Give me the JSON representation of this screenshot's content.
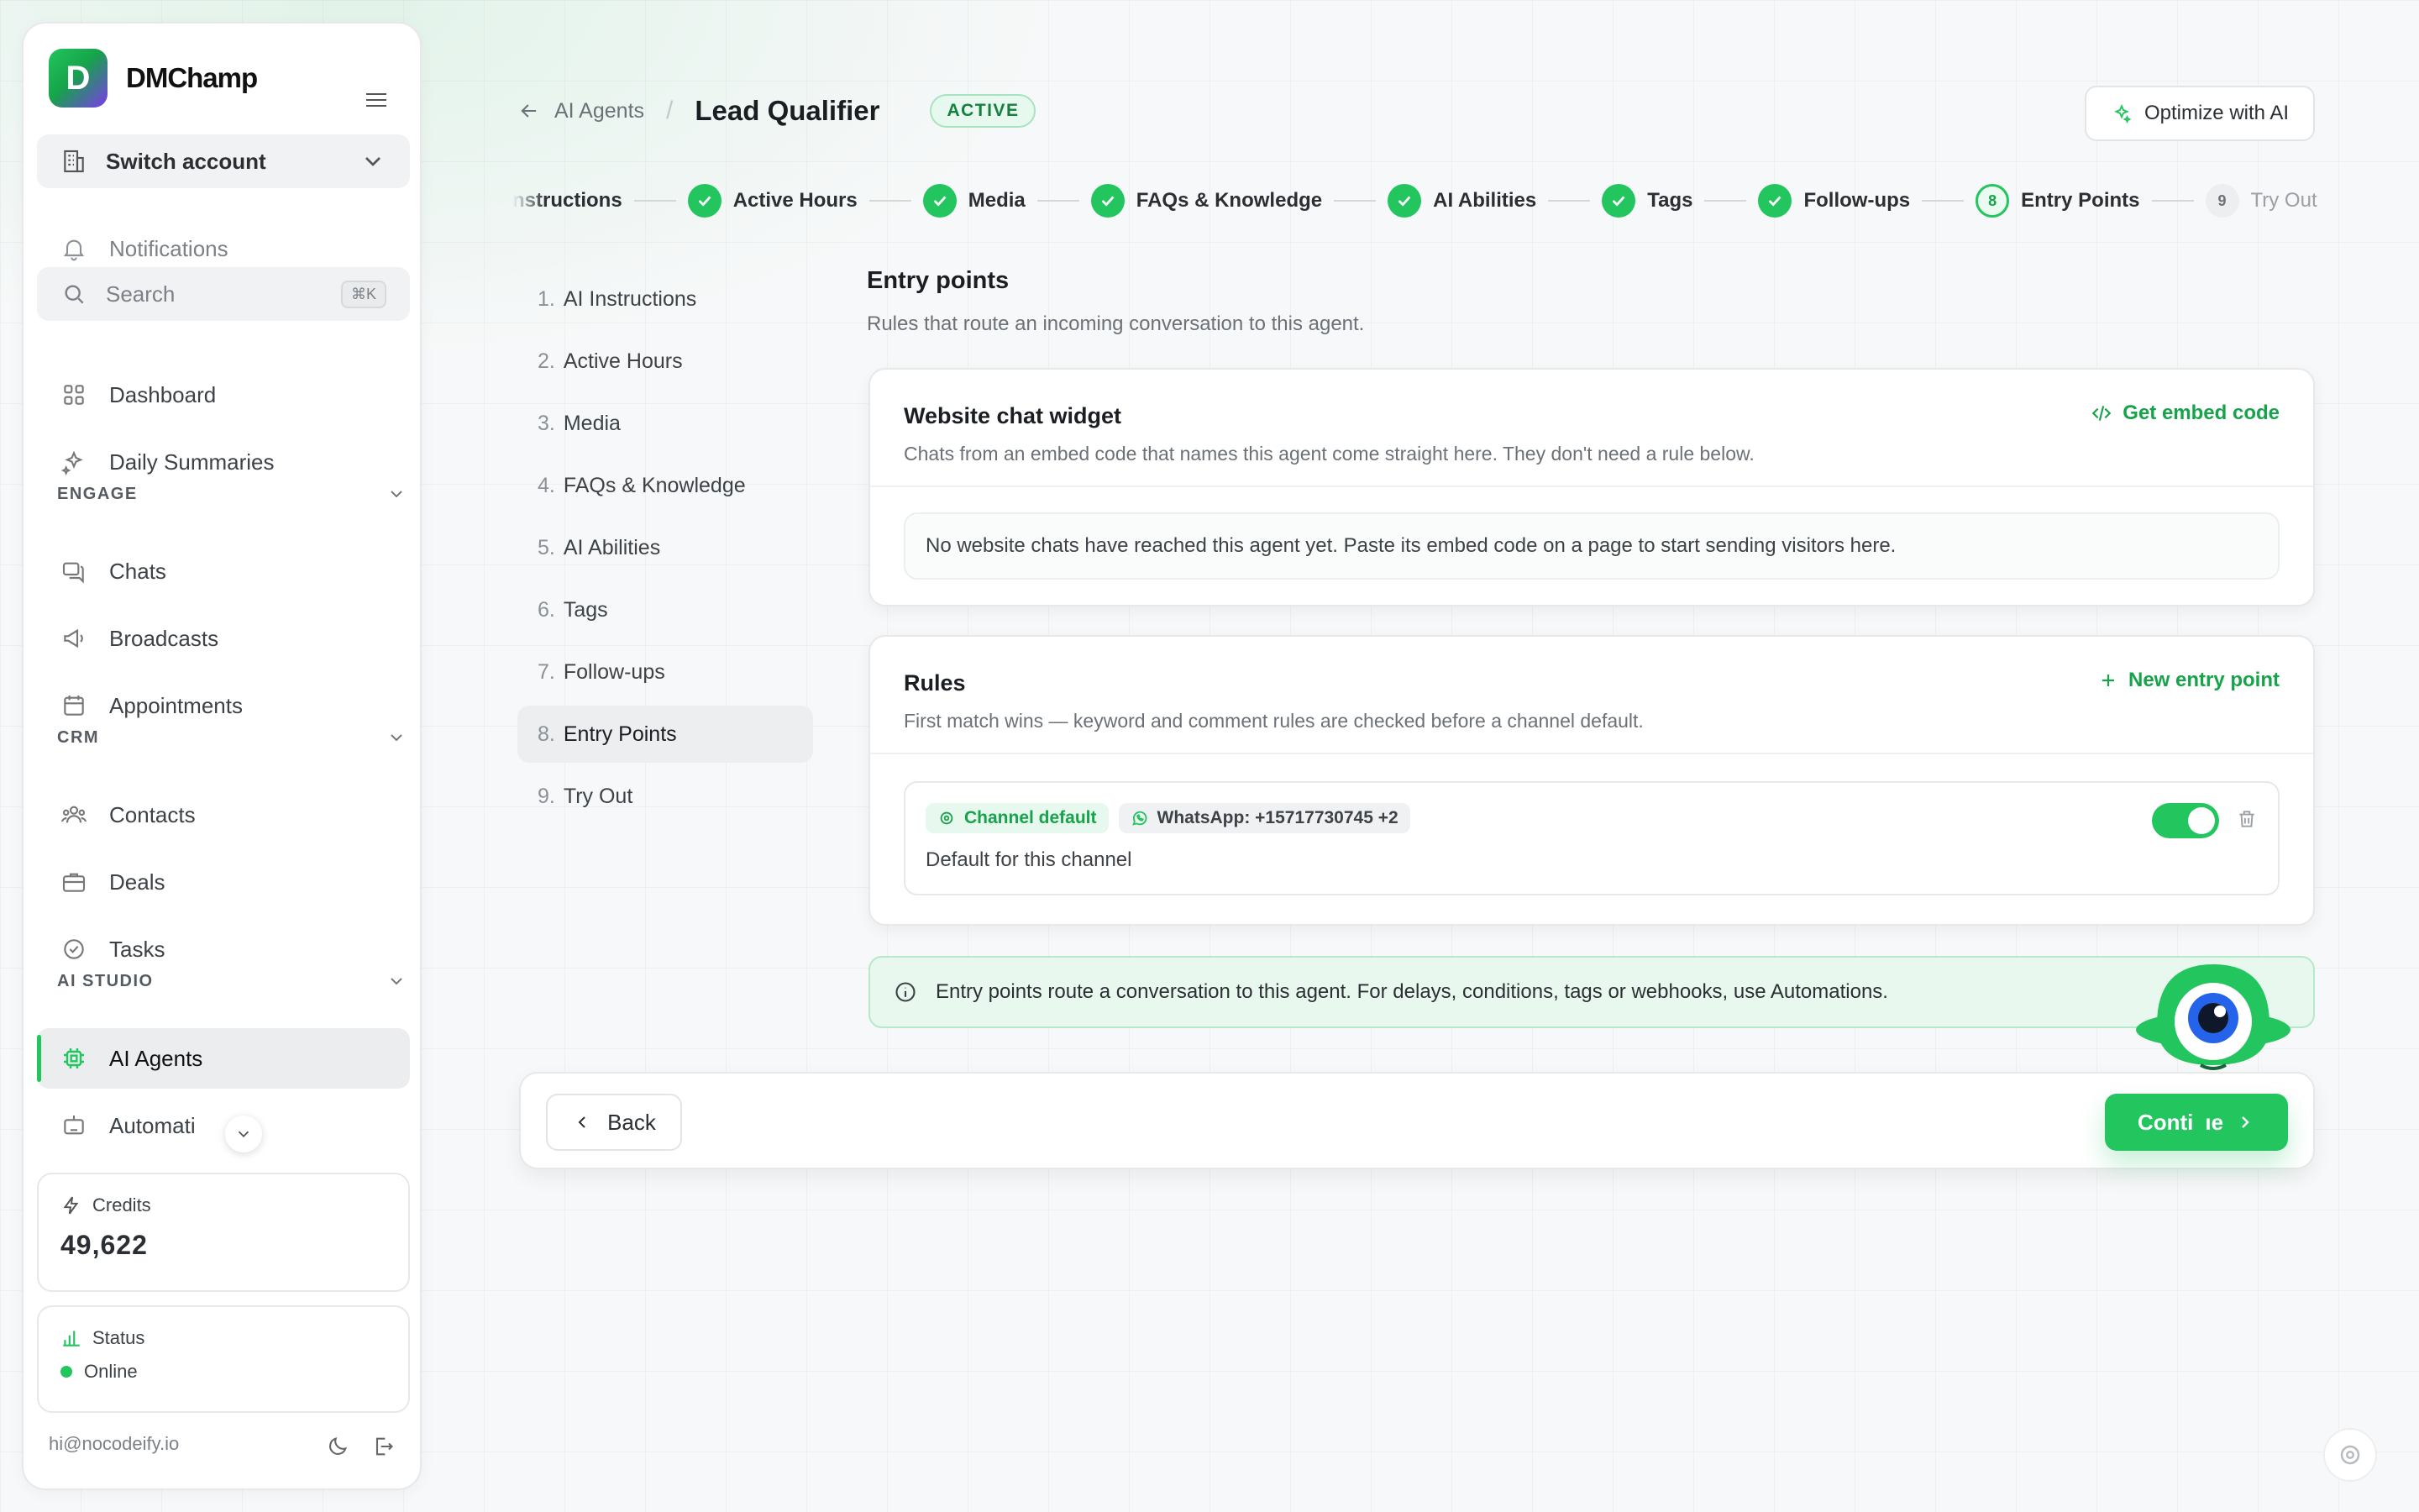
{
  "app": {
    "brand": "DMChamp",
    "brand_letter": "D"
  },
  "sidebar": {
    "switch_account": "Switch account",
    "notifications": "Notifications",
    "search": {
      "label": "Search",
      "shortcut": "⌘K"
    },
    "dashboard": "Dashboard",
    "daily_summaries": "Daily Summaries",
    "sections": {
      "engage": "ENGAGE",
      "crm": "CRM",
      "ai_studio": "AI STUDIO"
    },
    "engage_items": {
      "chats": "Chats",
      "broadcasts": "Broadcasts",
      "appointments": "Appointments"
    },
    "crm_items": {
      "contacts": "Contacts",
      "deals": "Deals",
      "tasks": "Tasks"
    },
    "ai_items": {
      "ai_agents": "AI Agents",
      "automations": "Automati"
    },
    "credits": {
      "label": "Credits",
      "value": "49,622"
    },
    "status": {
      "label": "Status",
      "value": "Online"
    },
    "user_email": "hi@nocodeify.io"
  },
  "header": {
    "back_label": "AI Agents",
    "separator": "/",
    "title": "Lead Qualifier",
    "status": "ACTIVE",
    "optimize_button": "Optimize with AI"
  },
  "stepper": {
    "steps": [
      {
        "label": "nstructions",
        "state": "done"
      },
      {
        "label": "Active Hours",
        "state": "done"
      },
      {
        "label": "Media",
        "state": "done"
      },
      {
        "label": "FAQs & Knowledge",
        "state": "done"
      },
      {
        "label": "AI Abilities",
        "state": "done"
      },
      {
        "label": "Tags",
        "state": "done"
      },
      {
        "label": "Follow-ups",
        "state": "done"
      },
      {
        "label": "Entry Points",
        "number": "8",
        "state": "current"
      },
      {
        "label": "Try Out",
        "number": "9",
        "state": "todo"
      }
    ]
  },
  "step_list": [
    {
      "num": "1.",
      "label": "AI Instructions"
    },
    {
      "num": "2.",
      "label": "Active Hours"
    },
    {
      "num": "3.",
      "label": "Media"
    },
    {
      "num": "4.",
      "label": "FAQs & Knowledge"
    },
    {
      "num": "5.",
      "label": "AI Abilities"
    },
    {
      "num": "6.",
      "label": "Tags"
    },
    {
      "num": "7.",
      "label": "Follow-ups"
    },
    {
      "num": "8.",
      "label": "Entry Points"
    },
    {
      "num": "9.",
      "label": "Try Out"
    }
  ],
  "content": {
    "title": "Entry points",
    "subtitle": "Rules that route an incoming conversation to this agent.",
    "widget": {
      "title": "Website chat widget",
      "desc": "Chats from an embed code that names this agent come straight here. They don't need a rule below.",
      "link": "Get embed code",
      "empty": "No website chats have reached this agent yet. Paste its embed code on a page to start sending visitors here."
    },
    "rules": {
      "title": "Rules",
      "desc": "First match wins — keyword and comment rules are checked before a channel default.",
      "link": "New entry point",
      "rule": {
        "chip_type": "Channel default",
        "chip_channel": "WhatsApp: +15717730745 +2",
        "text": "Default for this channel",
        "enabled": true
      }
    },
    "info": "Entry points route a conversation to this agent. For delays, conditions, tags or webhooks, use Automations."
  },
  "footer": {
    "back": "Back",
    "continue_a": "Conti",
    "continue_b": "ıe"
  },
  "colors": {
    "accent": "#22c55e",
    "accent_dark": "#16a34a",
    "mascot_blue": "#2563eb"
  }
}
